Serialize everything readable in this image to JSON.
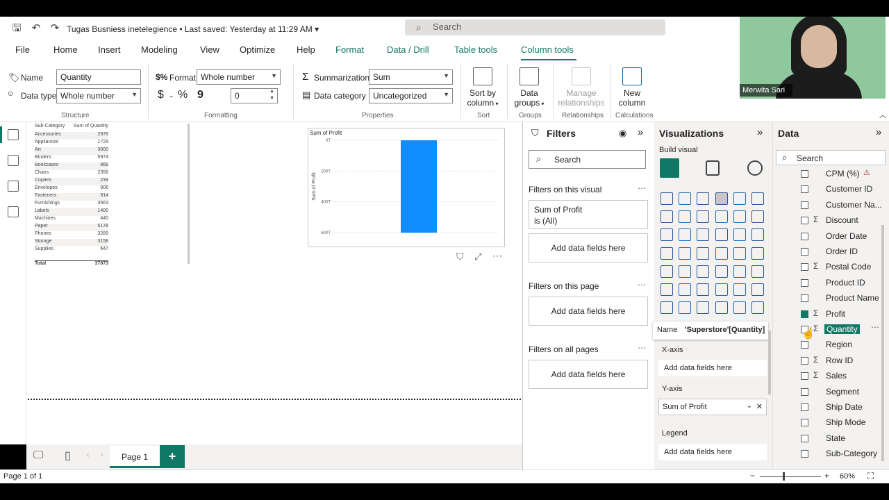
{
  "titlebar": {
    "doc_title": "Tugas Busniess inetelegience",
    "saved": "Last saved: Yesterday at 11:29 AM",
    "search": "Search"
  },
  "menu": [
    "File",
    "Home",
    "Insert",
    "Modeling",
    "View",
    "Optimize",
    "Help",
    "Format",
    "Data / Drill",
    "Table tools",
    "Column tools"
  ],
  "ribbon": {
    "name_label": "Name",
    "name_value": "Quantity",
    "datatype_label": "Data type",
    "datatype_value": "Whole number",
    "structure": "Structure",
    "format_label": "Format",
    "format_value": "Whole number",
    "currency": "$",
    "percent": "%",
    "comma": "9",
    "decimals": "0",
    "formatting": "Formatting",
    "summarization_label": "Summarization",
    "summarization_value": "Sum",
    "category_label": "Data category",
    "category_value": "Uncategorized",
    "properties": "Properties",
    "sort_btn": "Sort by",
    "sort_btn2": "column",
    "sort_group": "Sort",
    "groups_btn": "Data",
    "groups_btn2": "groups",
    "groups_group": "Groups",
    "manage_btn": "Manage",
    "manage_btn2": "relationships",
    "rel_group": "Relationships",
    "newcol_btn": "New",
    "newcol_btn2": "column",
    "calc_group": "Calculations"
  },
  "table_visual": {
    "headers": [
      "Sub-Category",
      "Sum of Quantity"
    ],
    "rows": [
      [
        "Accessories",
        "2976"
      ],
      [
        "Appliances",
        "1729"
      ],
      [
        "Art",
        "3000"
      ],
      [
        "Binders",
        "5974"
      ],
      [
        "Bookcases",
        "868"
      ],
      [
        "Chairs",
        "2356"
      ],
      [
        "Copiers",
        "234"
      ],
      [
        "Envelopes",
        "906"
      ],
      [
        "Fasteners",
        "914"
      ],
      [
        "Furnishings",
        "3563"
      ],
      [
        "Labels",
        "1400"
      ],
      [
        "Machines",
        "440"
      ],
      [
        "Paper",
        "5178"
      ],
      [
        "Phones",
        "3289"
      ],
      [
        "Storage",
        "3158"
      ],
      [
        "Supplies",
        "647"
      ]
    ],
    "total_label": "Total",
    "total_value": "37873"
  },
  "chart_data": {
    "type": "bar",
    "title": "Sum of Profit",
    "ylabel": "Sum of Profit",
    "y_ticks": [
      "0T",
      "200T",
      "400T",
      "600T"
    ],
    "categories": [
      ""
    ],
    "values": [
      600
    ],
    "ylim": [
      0,
      600
    ]
  },
  "filters": {
    "title": "Filters",
    "search": "Search",
    "on_visual": "Filters on this visual",
    "card_title": "Sum of Profit",
    "card_sub": "is (All)",
    "add": "Add data fields here",
    "on_page": "Filters on this page",
    "all_pages": "Filters on all pages"
  },
  "viz": {
    "title": "Visualizations",
    "build": "Build visual",
    "tooltip_name": "Name",
    "tooltip_value": "'Superstore'[Quantity]",
    "xaxis": "X-axis",
    "yaxis": "Y-axis",
    "y_field": "Sum of Profit",
    "legend": "Legend",
    "add": "Add data fields here"
  },
  "data_pane": {
    "title": "Data",
    "search": "Search",
    "fields": [
      {
        "name": "CPM (%)",
        "sigma": "",
        "checked": false
      },
      {
        "name": "Customer ID",
        "sigma": "",
        "checked": false
      },
      {
        "name": "Customer Na...",
        "sigma": "",
        "checked": false
      },
      {
        "name": "Discount",
        "sigma": "Σ",
        "checked": false
      },
      {
        "name": "Order Date",
        "sigma": "",
        "checked": false
      },
      {
        "name": "Order ID",
        "sigma": "",
        "checked": false
      },
      {
        "name": "Postal Code",
        "sigma": "Σ",
        "checked": false
      },
      {
        "name": "Product ID",
        "sigma": "",
        "checked": false
      },
      {
        "name": "Product Name",
        "sigma": "",
        "checked": false
      },
      {
        "name": "Profit",
        "sigma": "Σ",
        "checked": true
      },
      {
        "name": "Quantity",
        "sigma": "Σ",
        "checked": false
      },
      {
        "name": "Region",
        "sigma": "",
        "checked": false
      },
      {
        "name": "Row ID",
        "sigma": "Σ",
        "checked": false
      },
      {
        "name": "Sales",
        "sigma": "Σ",
        "checked": false
      },
      {
        "name": "Segment",
        "sigma": "",
        "checked": false
      },
      {
        "name": "Ship Date",
        "sigma": "",
        "checked": false
      },
      {
        "name": "Ship Mode",
        "sigma": "",
        "checked": false
      },
      {
        "name": "State",
        "sigma": "",
        "checked": false
      },
      {
        "name": "Sub-Category",
        "sigma": "",
        "checked": false
      }
    ]
  },
  "pages": {
    "page1": "Page 1",
    "add": "+"
  },
  "status": {
    "page": "Page 1 of 1",
    "zoom": "60%",
    "zoom_level": 0.6
  },
  "webcam": {
    "name": "Merwita Sari"
  },
  "colors": {
    "accent": "#117865",
    "bar": "#118DFF"
  }
}
